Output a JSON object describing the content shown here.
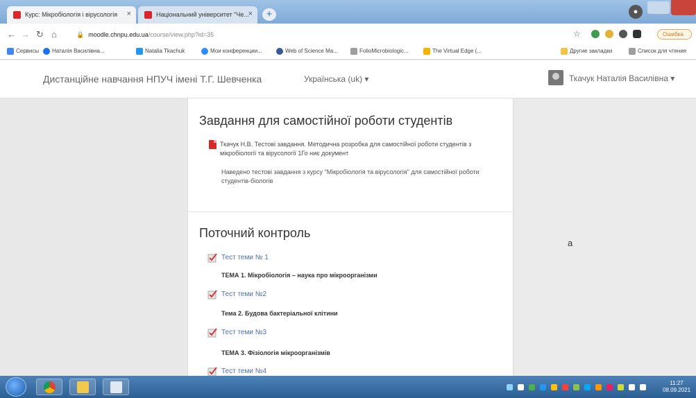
{
  "browser": {
    "tabs": [
      {
        "title": "Курс: Мікробіологія і вірусологія",
        "active": true
      },
      {
        "title": "Національний університет \"Че...",
        "active": false
      }
    ],
    "new_tab": "+",
    "url_host": "moodle.chnpu.edu.ua",
    "url_path": "/course/view.php?id=35",
    "update_pill": "Ошибка",
    "bookmarks": [
      {
        "label": "Сервисы",
        "color": "#4285f4"
      },
      {
        "label": "Наталія Василівна...",
        "color": "#1a73e8"
      },
      {
        "label": "Natalia Tkachuk",
        "color": "#2196f3"
      },
      {
        "label": "Мои конференции...",
        "color": "#2d8cff"
      },
      {
        "label": "Web of Science Ma...",
        "color": "#3b5998"
      },
      {
        "label": "FolioMicrobiologic...",
        "color": "#9e9e9e"
      },
      {
        "label": "The Virtual Edge (...",
        "color": "#f4b400"
      }
    ],
    "bookmarks_right": [
      {
        "label": "Другие закладки",
        "color": "#f4c542"
      },
      {
        "label": "Список для чтения",
        "color": "#9e9e9e"
      }
    ]
  },
  "header": {
    "site_name": "Дистанційне навчання НПУЧ імені Т.Г. Шевченка",
    "language": "Українська (uk) ▾",
    "user_name": "Ткачук Наталія Василівна ▾"
  },
  "sections": [
    {
      "title": "Завдання для самостійної роботи студентів",
      "resource": {
        "link": "Ткачук Н.В. Тестові завдання. Методична розробка для самостійної роботи студентів з мікробіології та вірусології 1Го ниє документ",
        "description": "Наведено тестові завдання з курсу \"Мікробіологія та вірусологія\" для самостійної роботи студентів-біологів"
      }
    },
    {
      "title": "Поточний контроль",
      "items": [
        {
          "quiz": "Тест теми № 1",
          "topic": "ТЕМА 1. Мікробіологія – наука про мікроорганізми"
        },
        {
          "quiz": "Тест теми №2",
          "topic": "Тема 2. Будова бактеріальної клітини"
        },
        {
          "quiz": "Тест теми №3",
          "topic": "ТЕМА 3. Фізіологія мікроорганізмів"
        },
        {
          "quiz": "Тест теми №4",
          "topic": ""
        }
      ]
    }
  ],
  "right_marker": "а",
  "taskbar": {
    "clock_time": "11:27",
    "clock_date": "08.09.2021"
  },
  "colors": {
    "accent_link": "#4d6fa7",
    "pdf_red": "#d42a2a",
    "taskbar": "#2c5f93"
  }
}
